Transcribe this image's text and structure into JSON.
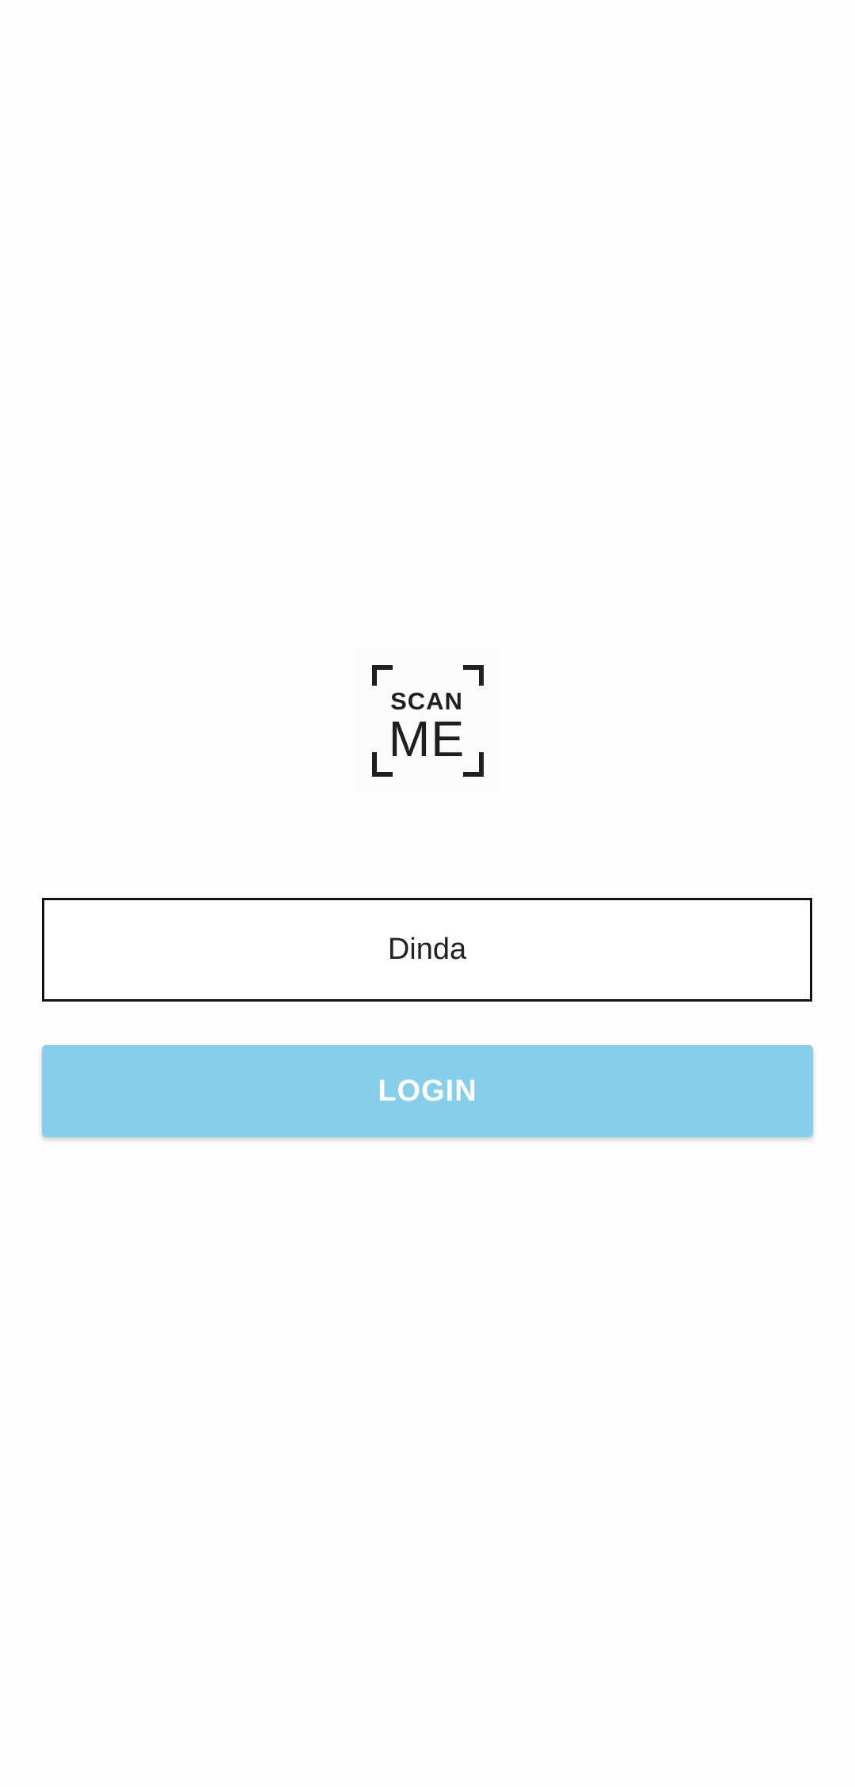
{
  "logo": {
    "line1": "SCAN",
    "line2": "ME"
  },
  "form": {
    "name_value": "Dinda",
    "login_label": "LOGIN"
  },
  "colors": {
    "background": "#fdfdfd",
    "button": "#87ceeb",
    "button_text": "#ffffff",
    "input_border": "#111111",
    "logo": "#1f1f1f"
  }
}
